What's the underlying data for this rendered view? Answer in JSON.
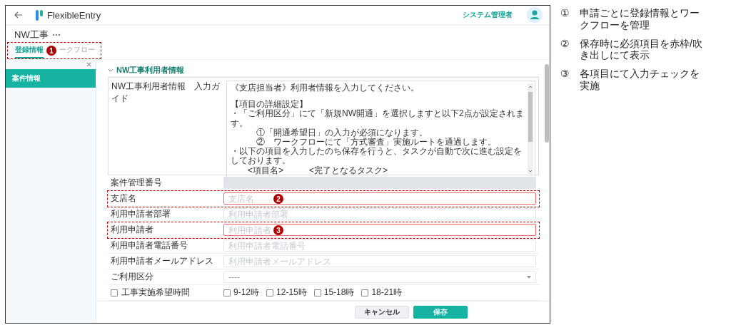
{
  "header": {
    "app_name": "FlexibleEntry",
    "user": "システム管理者"
  },
  "page": {
    "title": "NW工事"
  },
  "tabs": [
    {
      "label": "登録情報",
      "selected": true
    },
    {
      "label": "ークフロー",
      "selected": false,
      "marker": "1"
    }
  ],
  "sidebar": {
    "items": [
      {
        "label": "案件情報",
        "selected": true
      }
    ]
  },
  "section": {
    "title": "NW工事利用者情報",
    "expanded": true
  },
  "fields": [
    {
      "kind": "guide",
      "label": "NW工事利用者情報　入力ガイド",
      "paragraphs": [
        [
          "《支店担当者》利用者情報を入力してください。"
        ],
        [
          "【項目の詳細設定】",
          "・「ご利用区分」にて「新規NW開通」を選択しますと以下2点が設定されます。",
          "　　　①「開通希望日」の入力が必須になります。",
          "　　　②　ワークフローにて「方式審査」実施ルートを通過します。",
          "・以下の項目を入力したのち保存を行うと、タスクが自動で次に進む設定をしております。",
          "　　<項目名>　　　<完了となるタスク>"
        ]
      ]
    },
    {
      "kind": "readonly",
      "label": "案件管理番号"
    },
    {
      "kind": "text",
      "label": "支店名",
      "placeholder": "支店名",
      "error": true,
      "marker": "2"
    },
    {
      "kind": "text",
      "label": "利用申請者部署",
      "placeholder": "利用申請者部署",
      "error": false
    },
    {
      "kind": "text",
      "label": "利用申請者",
      "placeholder": "利用申請者",
      "error": true,
      "marker": "3"
    },
    {
      "kind": "text",
      "label": "利用申請者電話番号",
      "placeholder": "利用申請者電話番号",
      "error": false
    },
    {
      "kind": "text",
      "label": "利用申請者メールアドレス",
      "placeholder": "利用申請者メールアドレス",
      "error": false
    },
    {
      "kind": "select",
      "label": "ご利用区分",
      "value": "----"
    },
    {
      "kind": "checks",
      "label": "工事実施希望時間",
      "checked": false,
      "options": [
        {
          "label": "9-12時",
          "checked": false
        },
        {
          "label": "12-15時",
          "checked": false
        },
        {
          "label": "15-18時",
          "checked": false
        },
        {
          "label": "18-21時",
          "checked": false
        }
      ]
    }
  ],
  "buttons": [
    {
      "label": "キャンセル",
      "kind": "secondary"
    },
    {
      "label": "保存",
      "kind": "primary"
    }
  ],
  "notes": [
    {
      "number": "①",
      "text": "申請ごとに登録情報とワークフローを管理"
    },
    {
      "number": "②",
      "text": "保存時に必須項目を赤枠/吹き出しにて表示"
    },
    {
      "number": "③",
      "text": "各項目にて入力チェックを実施"
    }
  ]
}
